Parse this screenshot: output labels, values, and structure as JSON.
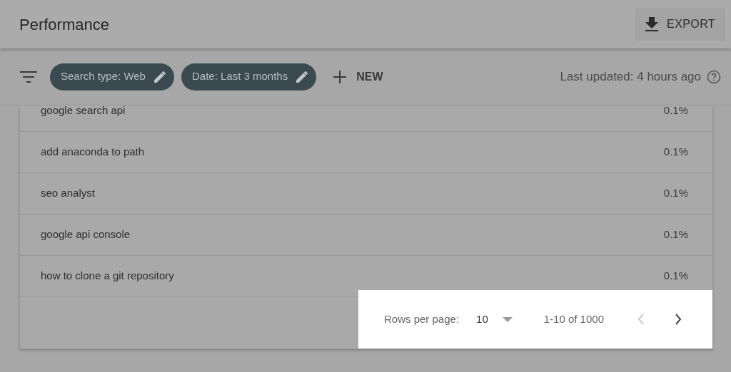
{
  "header": {
    "title": "Performance",
    "export_button": "EXPORT"
  },
  "toolbar": {
    "chips": [
      {
        "label": "Search type: Web"
      },
      {
        "label": "Date: Last 3 months"
      }
    ],
    "new_button": "NEW",
    "last_updated": "Last updated: 4 hours ago"
  },
  "table": {
    "rows": [
      {
        "query": "google search api",
        "value": "0.1%"
      },
      {
        "query": "add anaconda to path",
        "value": "0.1%"
      },
      {
        "query": "seo analyst",
        "value": "0.1%"
      },
      {
        "query": "google api console",
        "value": "0.1%"
      },
      {
        "query": "how to clone a git repository",
        "value": "0.1%"
      }
    ]
  },
  "pagination": {
    "rows_per_page_label": "Rows per page:",
    "rows_per_page": "10",
    "range": "1-10 of 1000",
    "prev_disabled": true,
    "next_disabled": false
  }
}
